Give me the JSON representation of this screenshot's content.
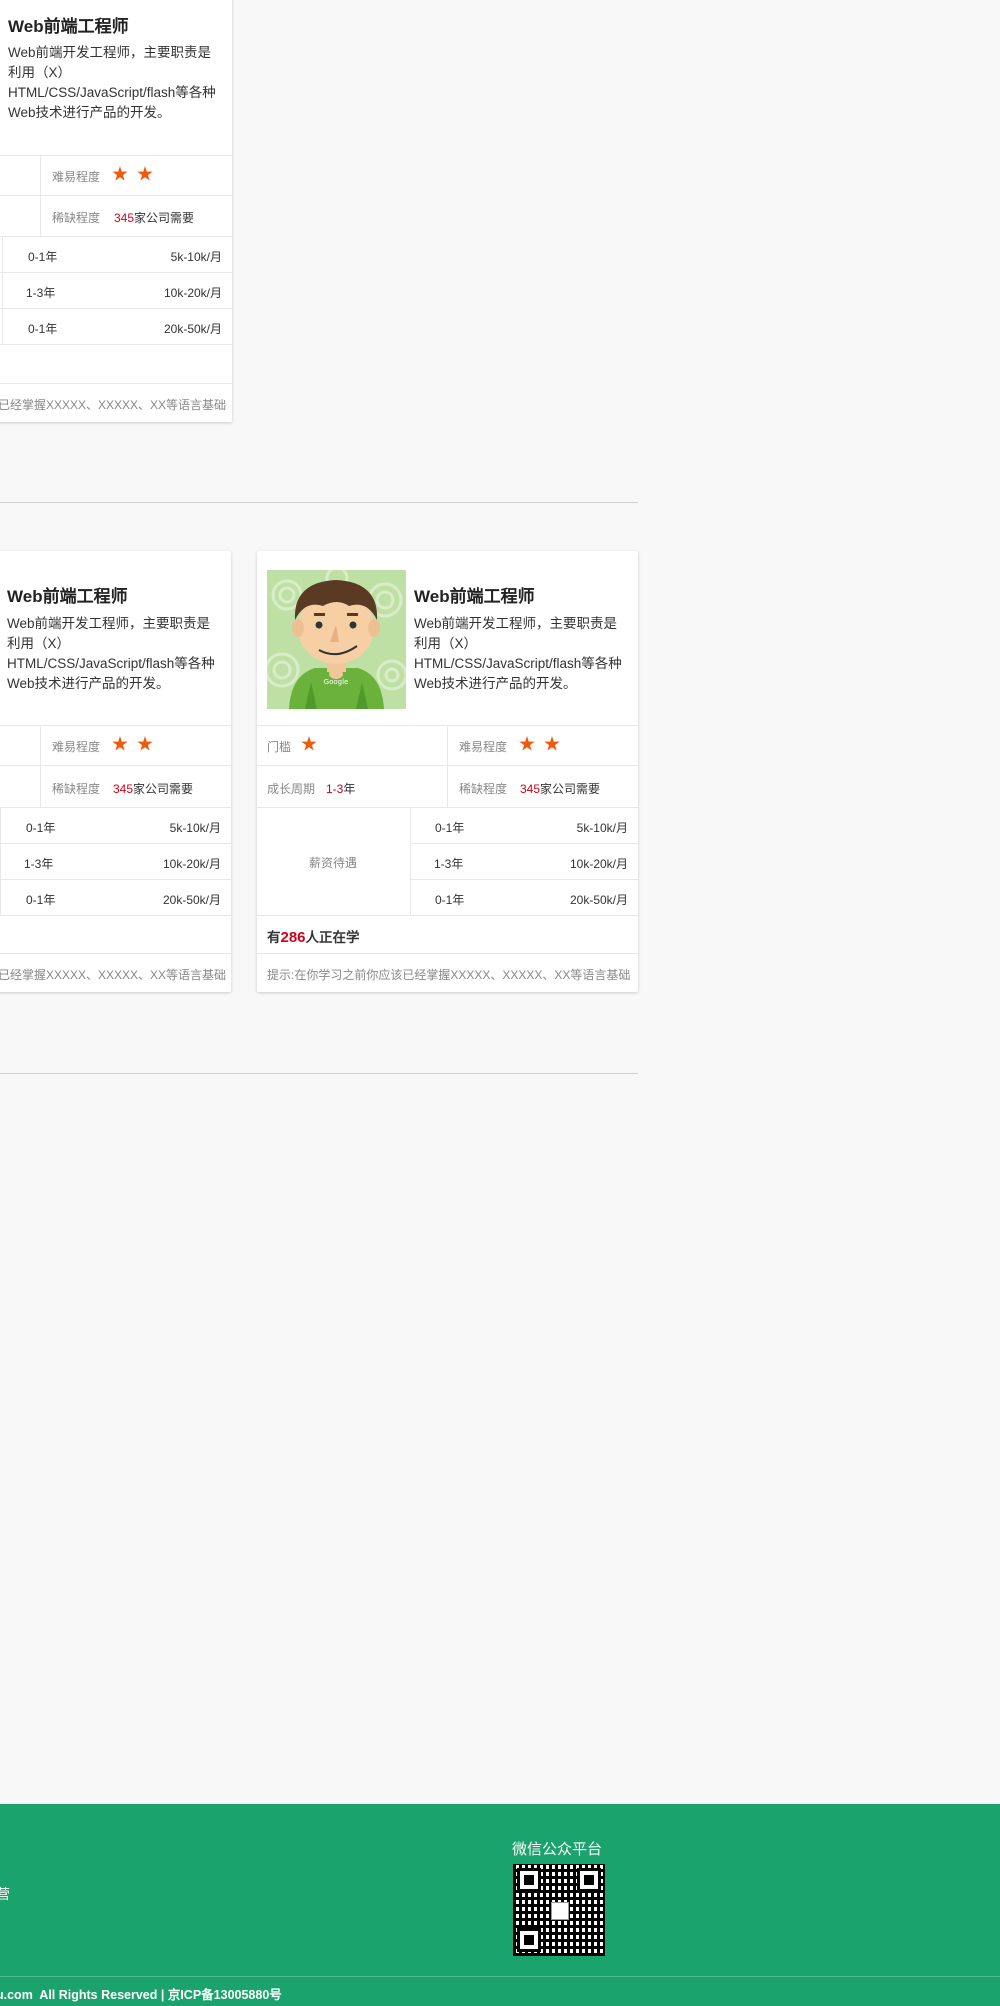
{
  "course": {
    "title": "Web前端工程师",
    "desc": "Web前端开发工程师，主要职责是利用（X）HTML/CSS/JavaScript/flash等各种Web技术进行产品的开发。"
  },
  "stats": {
    "threshold_label": "门槛",
    "difficulty_label": "难易程度",
    "cycle_label": "成长周期",
    "cycle_value": "1-3",
    "cycle_unit": "年",
    "scarcity_label": "稀缺程度",
    "scarcity_value": "345",
    "scarcity_unit": "家公司需要",
    "salary_label": "薪资待遇"
  },
  "salary": [
    {
      "years": "0-1年",
      "pay": "5k-10k/月"
    },
    {
      "years": "1-3年",
      "pay": "10k-20k/月"
    },
    {
      "years": "0-1年",
      "pay": "20k-50k/月"
    }
  ],
  "learners": {
    "prefix": "有",
    "count": "286",
    "suffix": "人正在学"
  },
  "tip": "提示:在你学习之前你应该已经掌握XXXXX、XXXXX、XX等语言基础",
  "tip_partial": "已经掌握XXXXX、XXXXX、XX等语言基础",
  "avatar_text": "Google",
  "footer": {
    "wechat_title": "微信公众平台",
    "left_fragment": "营",
    "copyright": "u.com  All Rights Reserved | 京ICP备13005880号"
  },
  "colors": {
    "accent_red": "#d0021b",
    "star": "#f05a0a",
    "footer": "#1aa36c"
  }
}
